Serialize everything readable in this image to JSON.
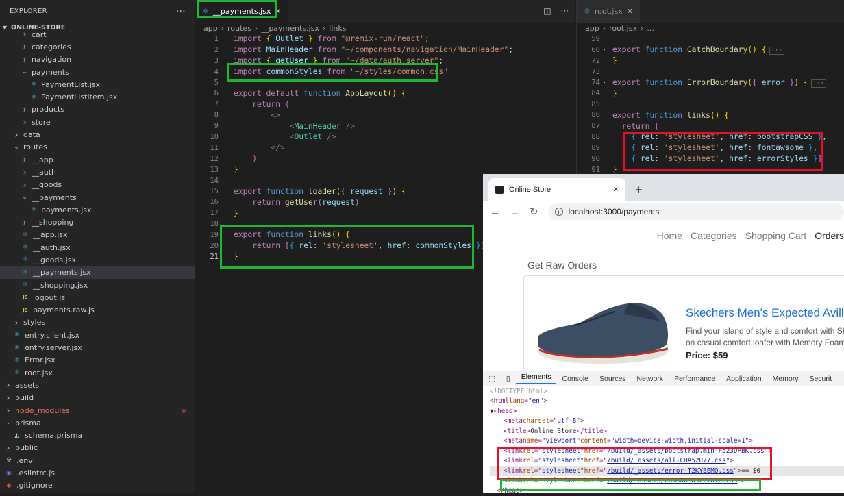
{
  "explorer": {
    "title": "EXPLORER",
    "more": "···",
    "project": "ONLINE-STORE",
    "items": [
      {
        "label": "cart",
        "ind": 2,
        "type": "folder-c"
      },
      {
        "label": "categories",
        "ind": 2,
        "type": "folder-c"
      },
      {
        "label": "navigation",
        "ind": 2,
        "type": "folder-c"
      },
      {
        "label": "payments",
        "ind": 2,
        "type": "folder-o"
      },
      {
        "label": "PaymentList.jsx",
        "ind": 3,
        "type": "jsx"
      },
      {
        "label": "PaymentListItem.jsx",
        "ind": 3,
        "type": "jsx"
      },
      {
        "label": "products",
        "ind": 2,
        "type": "folder-c"
      },
      {
        "label": "store",
        "ind": 2,
        "type": "folder-c"
      },
      {
        "label": "data",
        "ind": 1,
        "type": "folder-c"
      },
      {
        "label": "routes",
        "ind": 1,
        "type": "folder-o"
      },
      {
        "label": "__app",
        "ind": 2,
        "type": "folder-c"
      },
      {
        "label": "__auth",
        "ind": 2,
        "type": "folder-c"
      },
      {
        "label": "__goods",
        "ind": 2,
        "type": "folder-c"
      },
      {
        "label": "__payments",
        "ind": 2,
        "type": "folder-o"
      },
      {
        "label": "payments.jsx",
        "ind": 3,
        "type": "jsx"
      },
      {
        "label": "__shopping",
        "ind": 2,
        "type": "folder-c"
      },
      {
        "label": "__app.jsx",
        "ind": 2,
        "type": "jsx"
      },
      {
        "label": "__auth.jsx",
        "ind": 2,
        "type": "jsx"
      },
      {
        "label": "__goods.jsx",
        "ind": 2,
        "type": "jsx"
      },
      {
        "label": "__payments.jsx",
        "ind": 2,
        "type": "jsx",
        "selected": true
      },
      {
        "label": "__shopping.jsx",
        "ind": 2,
        "type": "jsx"
      },
      {
        "label": "logout.js",
        "ind": 2,
        "type": "js"
      },
      {
        "label": "payments.raw.js",
        "ind": 2,
        "type": "js"
      },
      {
        "label": "styles",
        "ind": 1,
        "type": "folder-c"
      },
      {
        "label": "entry.client.jsx",
        "ind": 1,
        "type": "jsx"
      },
      {
        "label": "entry.server.jsx",
        "ind": 1,
        "type": "jsx"
      },
      {
        "label": "Error.jsx",
        "ind": 1,
        "type": "jsx"
      },
      {
        "label": "root.jsx",
        "ind": 1,
        "type": "jsx"
      },
      {
        "label": "assets",
        "ind": 0,
        "type": "folder-c"
      },
      {
        "label": "build",
        "ind": 0,
        "type": "folder-c"
      },
      {
        "label": "node_modules",
        "ind": 0,
        "type": "folder-c",
        "nm": true
      },
      {
        "label": "prisma",
        "ind": 0,
        "type": "folder-o"
      },
      {
        "label": "schema.prisma",
        "ind": 1,
        "type": "pr"
      },
      {
        "label": "public",
        "ind": 0,
        "type": "folder-c"
      },
      {
        "label": ".env",
        "ind": 0,
        "type": "env"
      },
      {
        "label": ".eslintrc.js",
        "ind": 0,
        "type": "es"
      },
      {
        "label": ".gitignore",
        "ind": 0,
        "type": "git"
      }
    ]
  },
  "editor1": {
    "tab": "__payments.jsx",
    "breadcrumb": [
      "app",
      "routes",
      "__payments.jsx",
      "links"
    ],
    "lines": [
      {
        "n": "1",
        "h": "<span class=cf>import</span> <span class=b1>{</span> <span class=v>Outlet</span> <span class=b1>}</span> <span class=cf>from</span> <span class=s>\"@remix-run/react\"</span>;"
      },
      {
        "n": "2",
        "h": "<span class=cf>import</span> <span class=v>MainHeader</span> <span class=cf>from</span> <span class=s>\"~/components/navigation/MainHeader\"</span>;"
      },
      {
        "n": "3",
        "h": "<span class=cf>import</span> <span class=b1>{</span> <span class=v>getUser</span> <span class=b1>}</span> <span class=cf>from</span> <span class=s>\"~/data/auth.server\"</span>;"
      },
      {
        "n": "4",
        "h": "<span class=cf>import</span> <span class=v>commonStyles</span> <span class=cf>from</span> <span class=s>\"~/styles/common.css\"</span>"
      },
      {
        "n": "5",
        "h": ""
      },
      {
        "n": "6",
        "h": "<span class=cf>export</span> <span class=cf>default</span> <span class=k>function</span> <span class=f>AppLayout</span><span class=b1>()</span> <span class=b1>{</span>"
      },
      {
        "n": "7",
        "h": "    <span class=cf>return</span> <span class=b2>(</span>"
      },
      {
        "n": "8",
        "h": "        <span class=tg>&lt;&gt;</span>"
      },
      {
        "n": "9",
        "h": "            <span class=tg>&lt;</span><span class=t>MainHeader</span> <span class=tg>/&gt;</span>"
      },
      {
        "n": "10",
        "h": "            <span class=tg>&lt;</span><span class=t>Outlet</span> <span class=tg>/&gt;</span>"
      },
      {
        "n": "11",
        "h": "        <span class=tg>&lt;/&gt;</span>"
      },
      {
        "n": "12",
        "h": "    <span class=b2>)</span>"
      },
      {
        "n": "13",
        "h": "<span class=b1>}</span>"
      },
      {
        "n": "14",
        "h": ""
      },
      {
        "n": "15",
        "h": "<span class=cf>export</span> <span class=k>function</span> <span class=f>loader</span><span class=b1>(</span><span class=b2>{</span> <span class=v>request</span> <span class=b2>}</span><span class=b1>)</span> <span class=b1>{</span>"
      },
      {
        "n": "16",
        "h": "    <span class=cf>return</span> <span class=f>getUser</span><span class=b2>(</span><span class=v>request</span><span class=b2>)</span>"
      },
      {
        "n": "17",
        "h": "<span class=b1>}</span>"
      },
      {
        "n": "18",
        "h": ""
      },
      {
        "n": "19",
        "h": "<span class=cf>export</span> <span class=k>function</span> <span class=f>links</span><span class=b1>()</span> <span class=b1>{</span>"
      },
      {
        "n": "20",
        "h": "    <span class=cf>return</span> <span class=b2>[</span><span class=b3>{</span> <span class=v>rel</span>: <span class=s>'stylesheet'</span>, <span class=v>href</span>: <span class=v>commonStyles</span> <span class=b3>}</span><span class=b2>]</span>"
      },
      {
        "n": "21",
        "h": "<span class=b1>}</span>",
        "cur": true
      }
    ]
  },
  "editor2": {
    "tab": "root.jsx",
    "breadcrumb": [
      "app",
      "root.jsx",
      "..."
    ],
    "lines": [
      {
        "n": "59",
        "h": ""
      },
      {
        "n": "60",
        "fold": true,
        "h": "<span class=cf>export</span> <span class=k>function</span> <span class=f>CatchBoundary</span><span class=b1>()</span> <span class=b1>{</span><span class=coll>···</span>"
      },
      {
        "n": "72",
        "h": "<span class=b1>}</span>"
      },
      {
        "n": "73",
        "h": ""
      },
      {
        "n": "74",
        "fold": true,
        "h": "<span class=cf>export</span> <span class=k>function</span> <span class=f>ErrorBoundary</span><span class=b1>(</span><span class=b2>{</span> <span class=v>error</span> <span class=b2>}</span><span class=b1>)</span> <span class=b1>{</span><span class=coll>···</span>"
      },
      {
        "n": "84",
        "h": "<span class=b1>}</span>"
      },
      {
        "n": "85",
        "h": ""
      },
      {
        "n": "86",
        "h": "<span class=cf>export</span> <span class=k>function</span> <span class=f>links</span><span class=b1>()</span> <span class=b1>{</span>"
      },
      {
        "n": "87",
        "h": "  <span class=cf>return</span> <span class=b2>[</span>"
      },
      {
        "n": "88",
        "h": "    <span class=b3>{</span> <span class=v>rel</span>: <span class=s>'stylesheet'</span>, <span class=v>href</span>: <span class=v>bootstrapCSS</span> <span class=b3>}</span>,"
      },
      {
        "n": "89",
        "h": "    <span class=b3>{</span> <span class=v>rel</span>: <span class=s>'stylesheet'</span>, <span class=v>href</span>: <span class=v>fontawsome</span> <span class=b3>}</span>,"
      },
      {
        "n": "90",
        "h": "    <span class=b3>{</span> <span class=v>rel</span>: <span class=s>'stylesheet'</span>, <span class=v>href</span>: <span class=v>errorStyles</span> <span class=b3>}</span><span class=b2>]</span>"
      },
      {
        "n": "91",
        "h": "<span class=b1>}</span>"
      }
    ]
  },
  "browser": {
    "tab_title": "Online Store",
    "close": "✕",
    "new_tab": "+",
    "url": "localhost:3000/payments",
    "nav": [
      "Home",
      "Categories",
      "Shopping Cart",
      "Orders"
    ],
    "subheading": "Get Raw Orders",
    "product": {
      "title": "Skechers Men's Expected Avillo",
      "desc1": "Find your island of style and comfort with Ske",
      "desc2": "on casual comfort loafer with Memory Foam",
      "price": "Price: $59"
    },
    "devtools_tabs": [
      "Elements",
      "Console",
      "Sources",
      "Network",
      "Performance",
      "Application",
      "Memory",
      "Securit"
    ],
    "dom_lines": [
      {
        "ind": 0,
        "h": "<span class=dc>&lt;!DOCTYPE html&gt;</span>"
      },
      {
        "ind": 0,
        "h": "<span class=dt>&lt;html</span> <span class=da>lang</span>=<span class=dv>\"en\"</span><span class=dt>&gt;</span>"
      },
      {
        "ind": 0,
        "h": "<span class=dx>▼</span><span class=dt>&lt;head&gt;</span>"
      },
      {
        "ind": 2,
        "h": "<span class=dt>&lt;meta</span> <span class=da>charset</span>=<span class=dv>\"utf-8\"</span><span class=dt>&gt;</span>"
      },
      {
        "ind": 2,
        "h": "<span class=dt>&lt;title&gt;</span><span class=dx>Online Store</span><span class=dt>&lt;/title&gt;</span>"
      },
      {
        "ind": 2,
        "h": "<span class=dt>&lt;meta</span> <span class=da>name</span>=<span class=dv>\"viewport\"</span> <span class=da>content</span>=<span class=dv>\"width=device-width,initial-scale=1\"</span><span class=dt>&gt;</span>"
      },
      {
        "ind": 2,
        "h": "<span class=dt>&lt;link</span> <span class=da>rel</span>=<span class=dv>\"stylesheet\"</span> <span class=da>href</span>=<span class=dv>\"<span class=du>/build/_assets/bootstrap.min-F523DPBK.css</span>\"</span><span class=dt>&gt;</span>"
      },
      {
        "ind": 2,
        "h": "<span class=dt>&lt;link</span> <span class=da>rel</span>=<span class=dv>\"stylesheet\"</span> <span class=da>href</span>=<span class=dv>\"<span class=du>/build/_assets/all-CHA52U77.css</span>\"</span><span class=dt>&gt;</span>"
      },
      {
        "ind": 2,
        "hl": true,
        "h": "<span class=dt>&lt;link</span> <span class=da>rel</span>=<span class=dv>\"stylesheet\"</span> <span class=da>href</span>=<span class=dv>\"<span class=du>/build/_assets/error-T2KYBEMO.css</span>\"</span><span class=dt>&gt;</span> <span class=dx>== $0</span>"
      },
      {
        "ind": 2,
        "h": "<span class=dt>&lt;link</span> <span class=da>rel</span>=<span class=dv>\"stylesheet\"</span> <span class=da>href</span>=<span class=dv>\"<span class=du>/build/_assets/common-D5221OI6.css</span>\"</span><span class=dt>&gt;</span>"
      },
      {
        "ind": 1,
        "h": "<span class=dt>&lt;/head&gt;</span>"
      }
    ]
  },
  "colors": {
    "highlight_green": "#1fb535",
    "highlight_red": "#e8102a",
    "accent": "#1a73e8"
  }
}
